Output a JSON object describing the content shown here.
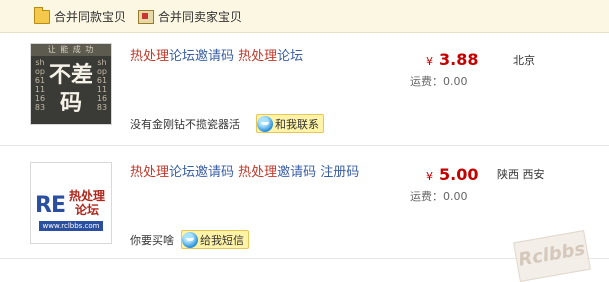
{
  "top_bar": {
    "merge_same_item": "合并同款宝贝",
    "merge_same_seller": "合并同卖家宝贝"
  },
  "items": [
    {
      "title_hl1": "热处理",
      "title_rest1": "论坛邀请码 ",
      "title_hl2": "热处理",
      "title_rest2": "论坛",
      "price_currency": "¥",
      "price": "3.88",
      "freight": "运费：0.00",
      "location": "北京",
      "seller_note": "没有金刚钻不揽瓷器活",
      "contact_label": "和我联系",
      "thumb_band_text": "让  能  成  功",
      "thumb_left_text": "shop61111683",
      "thumb_right_text": "shop61111683",
      "thumb_big_text": "不差码"
    },
    {
      "title_hl1": "热处理",
      "title_rest1": "论坛邀请码 ",
      "title_hl2": "热处理",
      "title_rest2": "邀请码 注册码",
      "price_currency": "¥",
      "price": "5.00",
      "freight": "运费：0.00",
      "location": "陕西 西安",
      "seller_note": "你要买啥",
      "contact_label": "给我短信",
      "thumb_logo": "RE",
      "thumb_cn1": "热处理",
      "thumb_cn2": "论坛",
      "thumb_url": "www.rclbbs.com"
    }
  ],
  "watermark": "Rclbbs"
}
